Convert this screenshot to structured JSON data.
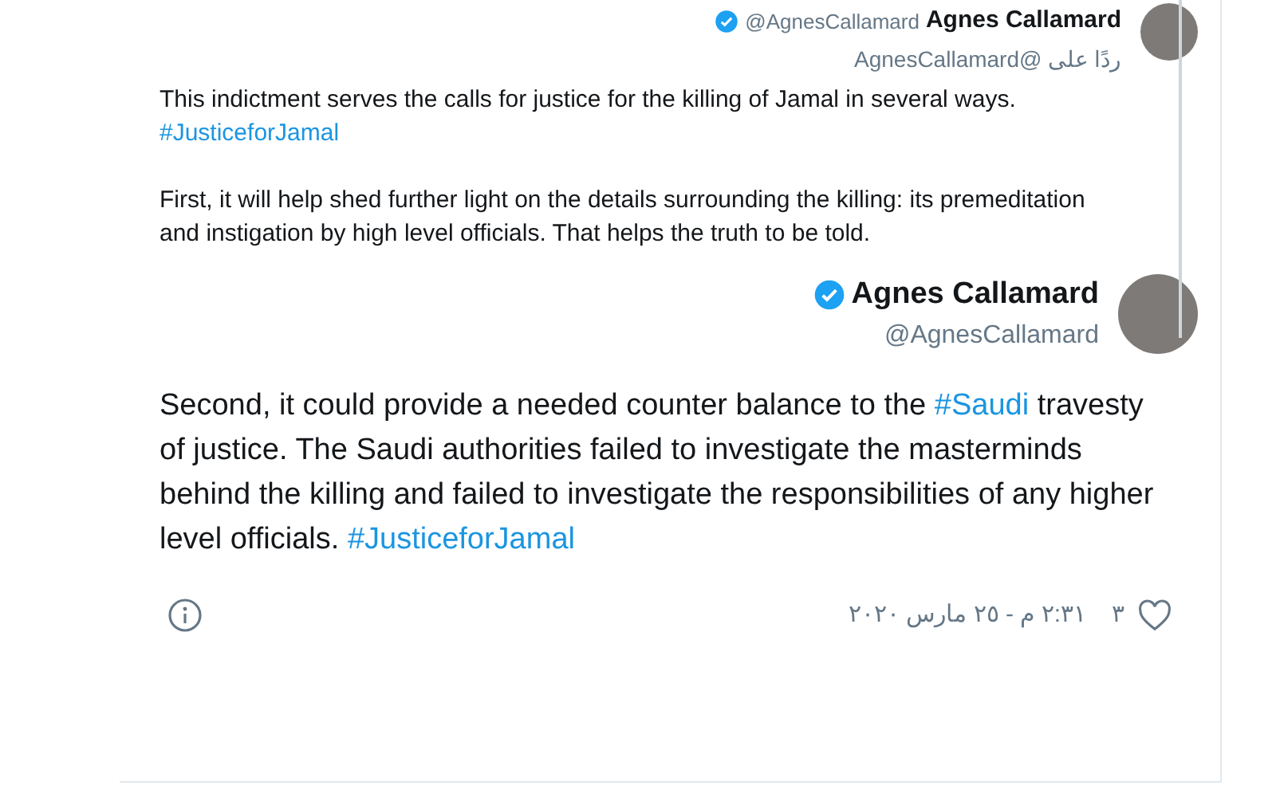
{
  "parent_tweet": {
    "name": "Agnes Callamard",
    "handle": "@AgnesCallamard",
    "verified": true,
    "reply_to": "ردًا على @AgnesCallamard",
    "paragraphs": [
      "This indictment serves the calls for justice for the killing of Jamal in several ways.  #JusticeforJamal",
      "First, it will help shed further light on the details surrounding the killing: its premeditation and instigation by high level officials.  That helps the truth to be told."
    ]
  },
  "tweet": {
    "name": "Agnes Callamard",
    "handle": "@AgnesCallamard",
    "verified": true,
    "text": "Second, it could provide a needed counter balance to the #Saudi travesty of justice. The Saudi authorities failed to investigate the masterminds behind the killing and failed to investigate the responsibilities of any higher level officials. #JusticeforJamal",
    "likes": "٣",
    "timestamp": "٢:٣١ م - ٢٥ مارس ٢٠٢٠"
  }
}
